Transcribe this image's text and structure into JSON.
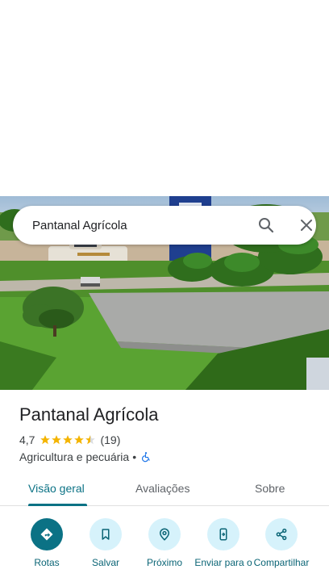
{
  "search": {
    "query": "Pantanal Agrícola",
    "search_icon": "search-icon",
    "close_icon": "close-icon"
  },
  "place": {
    "title": "Pantanal Agrícola",
    "rating": "4,7",
    "rating_value": 4.7,
    "review_count": "(19)",
    "category": "Agricultura e pecuária",
    "separator": "•",
    "accessibility_icon": "wheelchair-icon"
  },
  "tabs": [
    {
      "label": "Visão geral",
      "active": true
    },
    {
      "label": "Avaliações",
      "active": false
    },
    {
      "label": "Sobre",
      "active": false
    }
  ],
  "actions": [
    {
      "label": "Rotas",
      "icon": "directions-icon"
    },
    {
      "label": "Salvar",
      "icon": "bookmark-icon"
    },
    {
      "label": "Próximo",
      "icon": "nearby-icon"
    },
    {
      "label": "Enviar para o",
      "icon": "send-to-phone-icon"
    },
    {
      "label": "Compartilhar",
      "icon": "share-icon"
    }
  ],
  "colors": {
    "accent": "#0b7285",
    "action_bg": "#d6f2fb",
    "star": "#f4b400"
  }
}
